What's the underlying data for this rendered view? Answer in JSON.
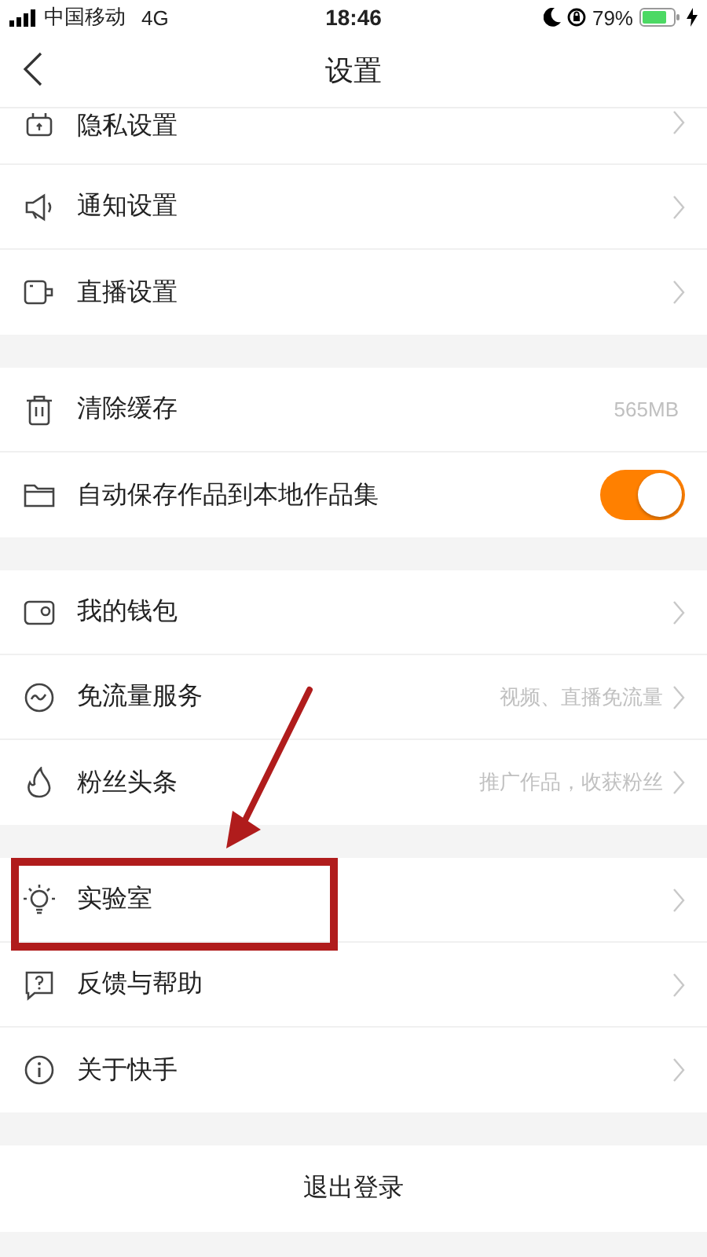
{
  "status_bar": {
    "carrier": "中国移动",
    "network": "4G",
    "time": "18:46",
    "battery": "79%"
  },
  "nav": {
    "title": "设置"
  },
  "groups": [
    {
      "rows": [
        {
          "label": "隐私设置",
          "kind": "link",
          "highlighted": false
        },
        {
          "label": "通知设置",
          "kind": "link",
          "highlighted": false
        },
        {
          "label": "直播设置",
          "kind": "link",
          "highlighted": false
        }
      ]
    },
    {
      "rows": [
        {
          "label": "清除缓存",
          "kind": "value",
          "value": "565MB",
          "highlighted": false
        },
        {
          "label": "自动保存作品到本地作品集",
          "kind": "toggle",
          "on": true,
          "highlighted": false
        }
      ]
    },
    {
      "rows": [
        {
          "label": "我的钱包",
          "kind": "link",
          "highlighted": false
        },
        {
          "label": "免流量服务",
          "kind": "link",
          "value": "视频、直播免流量",
          "highlighted": false
        },
        {
          "label": "粉丝头条",
          "kind": "link",
          "value": "推广作品，收获粉丝",
          "highlighted": false
        }
      ]
    },
    {
      "rows": [
        {
          "label": "实验室",
          "kind": "link",
          "highlighted": true
        },
        {
          "label": "反馈与帮助",
          "kind": "link",
          "highlighted": false
        },
        {
          "label": "关于快手",
          "kind": "link",
          "highlighted": false
        }
      ]
    }
  ],
  "logout": "退出登录"
}
